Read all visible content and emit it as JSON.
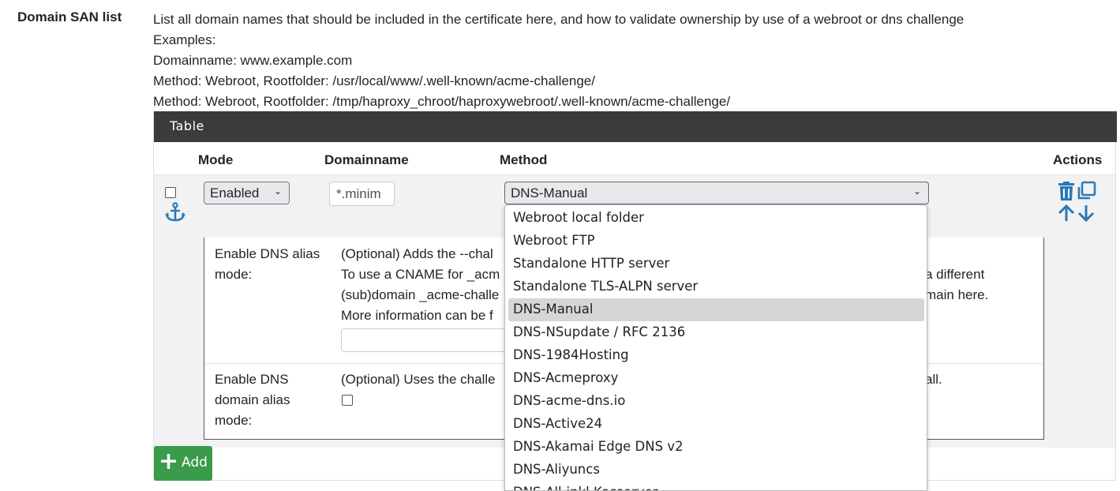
{
  "field_label": "Domain SAN list",
  "help_lines": [
    "List all domain names that should be included in the certificate here, and how to validate ownership by use of a webroot or dns challenge",
    "Examples:",
    "Domainname: www.example.com",
    "Method: Webroot, Rootfolder: /usr/local/www/.well-known/acme-challenge/",
    "Method: Webroot, Rootfolder: /tmp/haproxy_chroot/haproxywebroot/.well-known/acme-challenge/"
  ],
  "table": {
    "heading": "Table",
    "columns": {
      "mode": "Mode",
      "domainname": "Domainname",
      "method": "Method",
      "actions": "Actions"
    },
    "row": {
      "mode_value": "Enabled",
      "domain_value": "*.minim",
      "method_value": "DNS-Manual"
    }
  },
  "subtable": {
    "row1_label": [
      "Enable DNS alias",
      "mode:"
    ],
    "row1_text": [
      "(Optional) Adds the --chal",
      "To use a CNAME for _acm",
      "(sub)domain _acme-challe",
      "More information can be f"
    ],
    "row1_right": [
      "a different",
      "main here."
    ],
    "row2_label": [
      "Enable DNS",
      "domain alias",
      "mode:"
    ],
    "row2_text": "(Optional) Uses the challe",
    "row2_right": "all."
  },
  "add_button": "Add",
  "method_options": [
    "Webroot local folder",
    "Webroot FTP",
    "Standalone HTTP server",
    "Standalone TLS-ALPN server",
    "DNS-Manual",
    "DNS-NSupdate / RFC 2136",
    "DNS-1984Hosting",
    "DNS-Acmeproxy",
    "DNS-acme-dns.io",
    "DNS-Active24",
    "DNS-Akamai Edge DNS v2",
    "DNS-Aliyuncs",
    "DNS-All-inkl Kasserver"
  ],
  "selected_option_index": 4,
  "colors": {
    "heading_bg": "#3b3b3b",
    "add_button": "#3a9b4a",
    "icon": "#2a7ab8"
  }
}
